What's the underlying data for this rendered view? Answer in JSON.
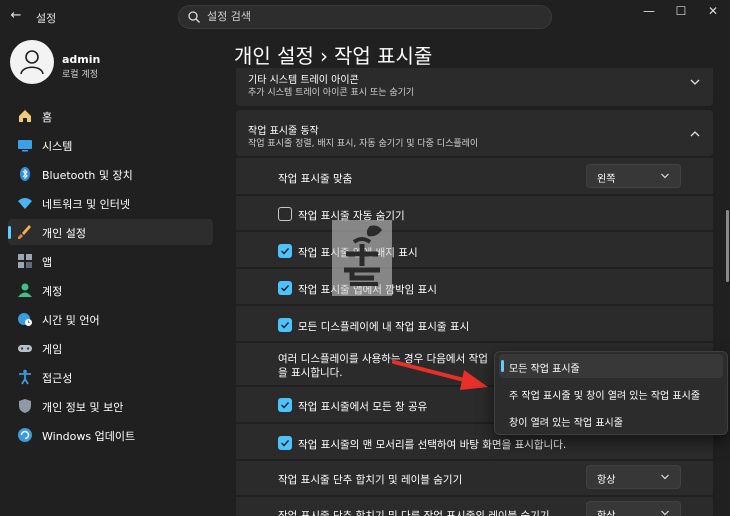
{
  "window": {
    "title": "설정",
    "back_glyph": "←",
    "controls": [
      "—",
      "☐",
      "✕"
    ]
  },
  "search": {
    "placeholder": "설정 검색"
  },
  "profile": {
    "name": "admin",
    "account_type": "로컬 계정"
  },
  "sidebar": {
    "items": [
      {
        "label": "홈",
        "icon": "home-icon"
      },
      {
        "label": "시스템",
        "icon": "system-icon"
      },
      {
        "label": "Bluetooth 및 장치",
        "icon": "bluetooth-icon"
      },
      {
        "label": "네트워크 및 인터넷",
        "icon": "wifi-icon"
      },
      {
        "label": "개인 설정",
        "icon": "brush-icon",
        "active": true
      },
      {
        "label": "앱",
        "icon": "apps-icon"
      },
      {
        "label": "계정",
        "icon": "account-icon"
      },
      {
        "label": "시간 및 언어",
        "icon": "globe-clock-icon"
      },
      {
        "label": "게임",
        "icon": "gamepad-icon"
      },
      {
        "label": "접근성",
        "icon": "accessibility-icon"
      },
      {
        "label": "개인 정보 및 보안",
        "icon": "shield-icon"
      },
      {
        "label": "Windows 업데이트",
        "icon": "update-icon"
      }
    ]
  },
  "breadcrumb": {
    "parent": "개인 설정",
    "separator": "›",
    "current": "작업 표시줄"
  },
  "sections": {
    "tray_icons": {
      "title": "기타 시스템 트레이 아이콘",
      "subtitle": "추가 시스템 트레이 아이콘 표시 또는 숨기기"
    },
    "behaviors": {
      "title": "작업 표시줄 동작",
      "subtitle": "작업 표시줄 정렬, 배지 표시, 자동 숨기기 및 다중 디스플레이"
    }
  },
  "settings": {
    "alignment": {
      "label": "작업 표시줄 맞춤",
      "value": "왼쪽"
    },
    "auto_hide": {
      "label": "작업 표시줄 자동 숨기기",
      "checked": false
    },
    "badges": {
      "label": "작업 표시줄 앱에 배지 표시",
      "checked": true
    },
    "flashing": {
      "label": "작업 표시줄 앱에서 깜박임 표시",
      "checked": true
    },
    "all_displays": {
      "label": "모든 디스플레이에 내 작업 표시줄 표시",
      "checked": true
    },
    "multi_display": {
      "line1": "여러 디스플레이를 사용하는 경우 다음에서 작업",
      "line2": "을 표시합니다."
    },
    "share_windows": {
      "label": "작업 표시줄에서 모든 창 공유",
      "checked": true
    },
    "corner": {
      "label": "작업 표시줄의 맨 모서리를 선택하여 바탕 화면을 표시합니다.",
      "checked": true
    },
    "combine_main": {
      "label": "작업 표시줄 단추 합치기 및 레이블 숨기기",
      "value": "항상"
    },
    "combine_other": {
      "label": "작업 표시줄 단추 합치기 및 다른 작업 표시줄의 레이블 숨기기",
      "value": "항상"
    }
  },
  "popup": {
    "options": [
      {
        "label": "모든 작업 표시줄",
        "selected": true
      },
      {
        "label": "주 작업 표시줄 및 창이 열려 있는 작업 표시줄",
        "selected": false
      },
      {
        "label": "창이 열려 있는 작업 표시줄",
        "selected": false
      }
    ]
  },
  "colors": {
    "background": "#202020",
    "card": "#2b2b2b",
    "accent": "#4cc2ff",
    "arrow": "#e8302a"
  }
}
